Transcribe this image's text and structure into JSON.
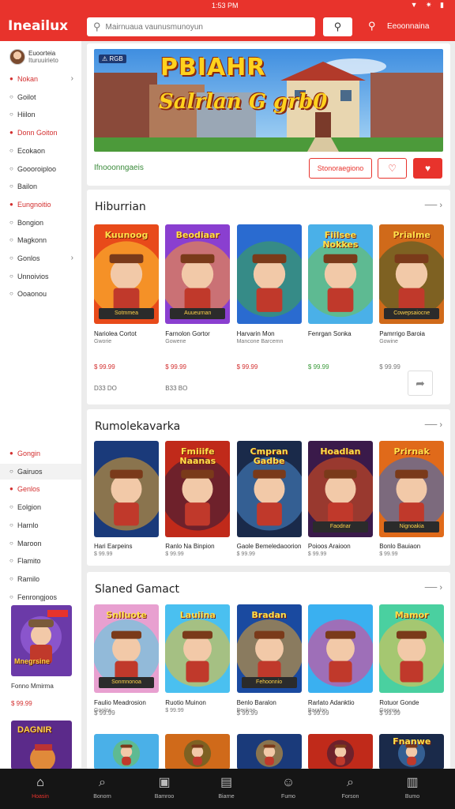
{
  "status": {
    "time": "1:53 PM",
    "icons": "▼ ✷ ▮"
  },
  "appbar": {
    "brand": "Ineailux",
    "search_placeholder": "Mairnuaua vaunusmunoyun",
    "search_button_icon": "search-icon",
    "bell_icon": "search-icon",
    "account_label": "Eeoonnaina"
  },
  "profile": {
    "name": "Euoorteia",
    "subtitle": "Ituruuirieto"
  },
  "sidebar": {
    "items": [
      {
        "label": "Nokan",
        "red": true,
        "chevron": true
      },
      {
        "label": "Goilot",
        "red": false
      },
      {
        "label": "Hiilon",
        "red": false
      },
      {
        "label": "Donn Goiton",
        "red": true
      },
      {
        "label": "Ecokaon",
        "red": false
      },
      {
        "label": "Goooroiploo",
        "red": false
      },
      {
        "label": "Bailon",
        "red": false
      },
      {
        "label": "Eungnoitio",
        "red": true
      },
      {
        "label": "Bongion",
        "red": false
      },
      {
        "label": "Magkonn",
        "red": false
      },
      {
        "label": "Gonlos",
        "red": false,
        "chevron": true
      },
      {
        "label": "Unnoivios",
        "red": false
      },
      {
        "label": "Ooaonou",
        "red": false
      }
    ],
    "items2": [
      {
        "label": "Gongin",
        "red": true
      },
      {
        "label": "Gairuos",
        "red": false,
        "selected": true
      },
      {
        "label": "Genlos",
        "red": true
      },
      {
        "label": "Eolgion",
        "red": false
      },
      {
        "label": "Harnlo",
        "red": false
      },
      {
        "label": "Maroon",
        "red": false
      },
      {
        "label": "Flamito",
        "red": false
      },
      {
        "label": "Ramilo",
        "red": false
      },
      {
        "label": "Fenrongjoos",
        "red": false
      }
    ],
    "promo1": {
      "title": "Mnegrsine",
      "name": "Fonno Mmirma",
      "price": "$ 99.99"
    },
    "promo2": {
      "title": "DAGNIR"
    }
  },
  "hero": {
    "tag": "⚠ RGB",
    "title": "PBIAHR",
    "subtitle": "Salrlan G grb0",
    "link": "Ifnooonngaeis",
    "primary_button": "Stonoraegiono",
    "icon_button_1": "heart-outline-icon",
    "icon_button_2": "heart-icon"
  },
  "sections": [
    {
      "title": "Hiburrian",
      "games": [
        {
          "thumb_title": "Kuunoog",
          "footer": "Sotmmea",
          "name": "Nariolea Cortot",
          "sub": "Gworie",
          "price": "$ 99.99",
          "price_color": "#d32f2f",
          "extra": "D33 DO"
        },
        {
          "thumb_title": "Beodiaar",
          "footer": "Auueurnan",
          "name": "Farnolon Gortor",
          "sub": "Gowene",
          "price": "$ 99.99",
          "price_color": "#d32f2f",
          "extra": "B33 BO"
        },
        {
          "thumb_title": "",
          "footer": "",
          "name": "Harvarin Mon",
          "sub": "Mancone Barcemn",
          "price": "$ 99.99",
          "price_color": "#d32f2f",
          "extra": ""
        },
        {
          "thumb_title": "Fiilsee Nokkes",
          "footer": "",
          "name": "Fenrgan Sonka",
          "sub": "",
          "price": "$ 99.99",
          "price_color": "#3a9a3a",
          "extra": ""
        },
        {
          "thumb_title": "Prialme",
          "footer": "Cowepsaiocne",
          "name": "Pamrrigo Baroia",
          "sub": "Gowine",
          "price": "$ 99.99",
          "price_color": "#777777",
          "extra": ""
        }
      ]
    },
    {
      "title": "Rumolekavarka",
      "games": [
        {
          "thumb_title": "",
          "footer": "",
          "name": "Hari Earpeins",
          "sub": "$ 99.99",
          "price": "",
          "price_color": "#777777",
          "extra": ""
        },
        {
          "thumb_title": "Fmiiife Naanas",
          "footer": "",
          "name": "Ranlo Na Binpion",
          "sub": "$ 99.99",
          "price": "",
          "price_color": "#777777",
          "extra": ""
        },
        {
          "thumb_title": "Cmpran Gadbe",
          "footer": "",
          "name": "Gaole Bemeledaoorion",
          "sub": "$ 99.99",
          "price": "",
          "price_color": "#777777",
          "extra": ""
        },
        {
          "thumb_title": "Hoadlan",
          "footer": "Faodnar",
          "name": "Poioos Araioon",
          "sub": "$ 99.99",
          "price": "",
          "price_color": "#777777",
          "extra": ""
        },
        {
          "thumb_title": "Prirnak",
          "footer": "Nignoakia",
          "name": "Bonlo Bauiaon",
          "sub": "$ 99.99",
          "price": "",
          "price_color": "#777777",
          "extra": ""
        }
      ]
    },
    {
      "title": "Slaned Gamact",
      "games": [
        {
          "thumb_title": "Snlluote",
          "footer": "Sonmnonoa",
          "name": "Faulio Meadrosion",
          "sub": "Gonlos",
          "price": "$ 99.99",
          "price_color": "#777777",
          "extra": ""
        },
        {
          "thumb_title": "Lauiina",
          "footer": "",
          "name": "Ruotio Muinon",
          "sub": "$ 99.99",
          "price": "",
          "price_color": "#777777",
          "extra": ""
        },
        {
          "thumb_title": "Bradan",
          "footer": "Fehoonnio",
          "name": "Benlo Baralon",
          "sub": "Benkon",
          "price": "$ 99.99",
          "price_color": "#777777",
          "extra": ""
        },
        {
          "thumb_title": "",
          "footer": "",
          "name": "Rarlato Adanktio",
          "sub": "Baralon",
          "price": "$ 99.99",
          "price_color": "#777777",
          "extra": ""
        },
        {
          "thumb_title": "Mamor",
          "footer": "",
          "name": "Rotuor Gonde",
          "sub": "Gonnou",
          "price": "$ 99.99",
          "price_color": "#777777",
          "extra": ""
        }
      ]
    }
  ],
  "row4": [
    "",
    "",
    "",
    "",
    "Fnanwe"
  ],
  "bottom_tabs": [
    {
      "label": "Hoasin",
      "icon": "home-icon",
      "glyph": "⌂"
    },
    {
      "label": "Bonorn",
      "icon": "search-icon",
      "glyph": "⌕"
    },
    {
      "label": "Bamroo",
      "icon": "gamepad-icon",
      "glyph": "▣"
    },
    {
      "label": "Biarne",
      "icon": "library-icon",
      "glyph": "▤"
    },
    {
      "label": "Fumo",
      "icon": "user-icon",
      "glyph": "☺"
    },
    {
      "label": "Forson",
      "icon": "search-icon",
      "glyph": "⌕"
    },
    {
      "label": "Bumo",
      "icon": "menu-icon",
      "glyph": "▥"
    }
  ]
}
